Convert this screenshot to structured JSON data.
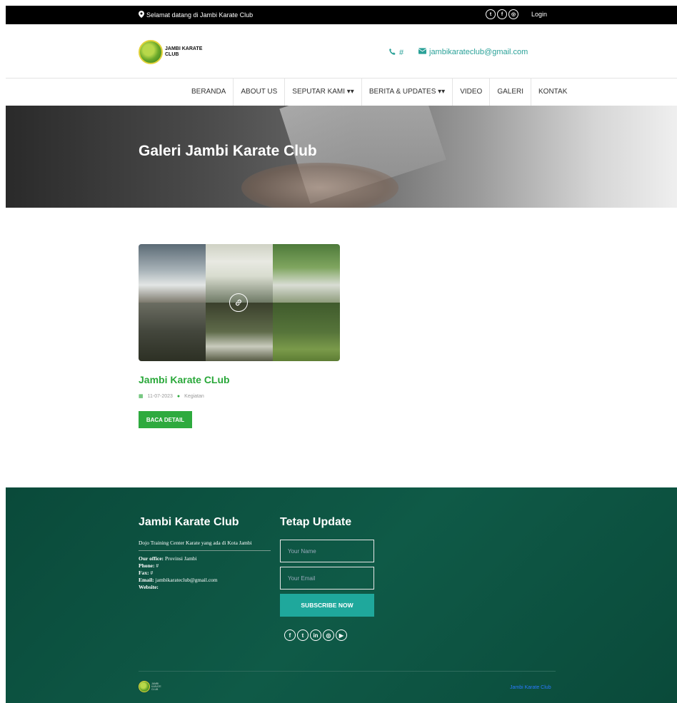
{
  "topbar": {
    "welcome": "Selamat datang di Jambi Karate Club",
    "socials": [
      "twitter-icon",
      "facebook-icon",
      "instagram-icon"
    ],
    "login": "Login"
  },
  "header": {
    "logo_text": "JAMBI KARATE CLUB",
    "phone": "#",
    "email": "jambikarateclub@gmail.com"
  },
  "nav": {
    "items": [
      {
        "label": "BERANDA"
      },
      {
        "label": "ABOUT US"
      },
      {
        "label": "SEPUTAR KAMI ▾▾"
      },
      {
        "label": "BERITA & UPDATES ▾▾"
      },
      {
        "label": "VIDEO"
      },
      {
        "label": "GALERI"
      },
      {
        "label": "KONTAK"
      }
    ]
  },
  "hero": {
    "title": "Galeri Jambi Karate Club"
  },
  "gallery": {
    "card": {
      "title": "Jambi Karate CLub",
      "date": "11-07-2023",
      "category": "Kegiatan",
      "button": "BACA DETAIL"
    }
  },
  "footer": {
    "about": {
      "title": "Jambi Karate Club",
      "description": "Dojo Training Center Karate yang ada di Kota Jambi",
      "office_label": "Our office:",
      "office_value": "Provinsi Jambi",
      "phone_label": "Phone:",
      "phone_value": "#",
      "fax_label": "Fax:",
      "fax_value": "#",
      "email_label": "Email:",
      "email_value": "jambikarateclub@gmail.com",
      "website_label": "Website:"
    },
    "subscribe": {
      "title": "Tetap Update",
      "name_placeholder": "Your Name",
      "email_placeholder": "Your Email",
      "button": "SUBSCRIBE NOW",
      "socials": [
        "facebook-icon",
        "twitter-icon",
        "linkedin-icon",
        "instagram-icon",
        "youtube-icon"
      ]
    },
    "copyright": "Jambi Karate Club"
  },
  "colors": {
    "accent_green": "#2eaa3e",
    "teal": "#1fa89c",
    "footer_bg": "#0a4a3a"
  }
}
